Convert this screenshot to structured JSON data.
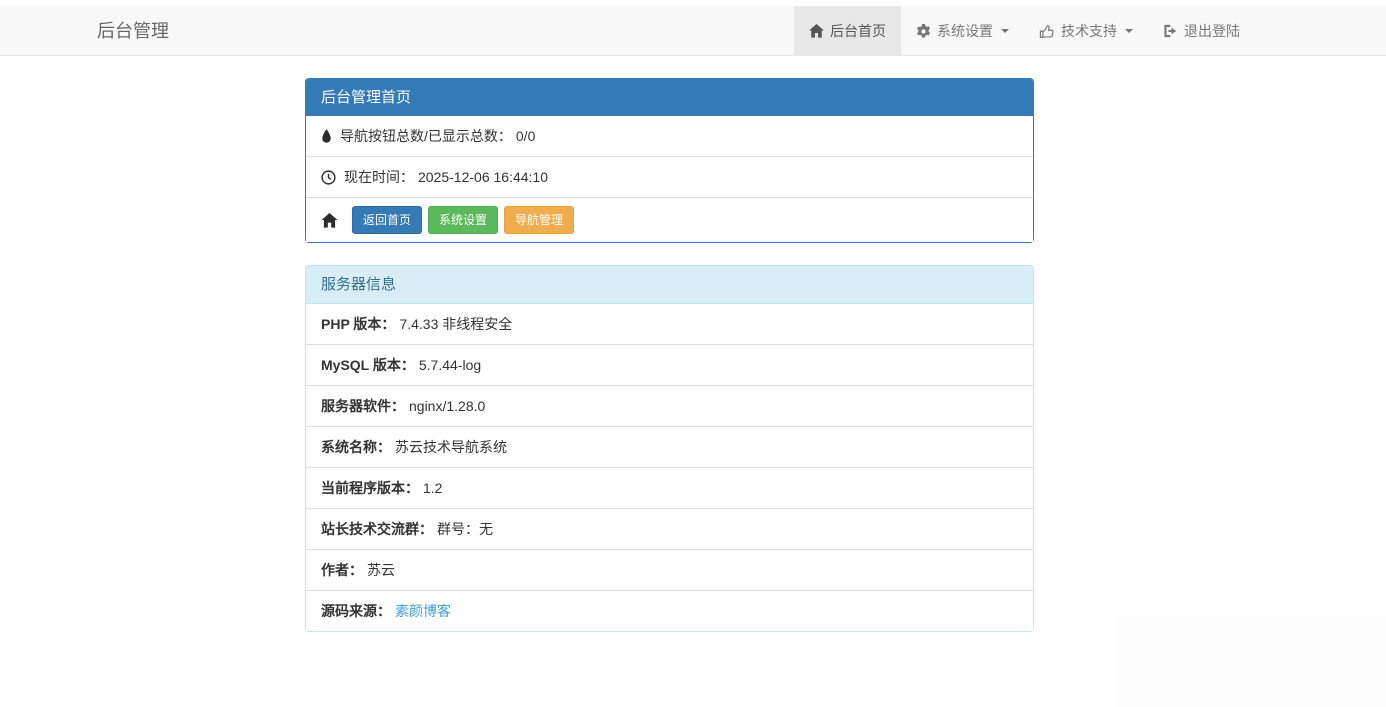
{
  "navbar": {
    "brand": "后台管理",
    "items": [
      {
        "label": "后台首页",
        "icon": "home-icon",
        "active": true
      },
      {
        "label": "系统设置",
        "icon": "gear-icon",
        "dropdown": true
      },
      {
        "label": "技术支持",
        "icon": "thumbs-up-icon",
        "dropdown": true
      },
      {
        "label": "退出登陆",
        "icon": "sign-out-icon"
      }
    ]
  },
  "dashboard": {
    "title": "后台管理首页",
    "nav_count_label": "导航按钮总数/已显示总数：",
    "nav_count_value": "0/0",
    "time_label": "现在时间：",
    "time_value": "2025-12-06 16:44:10",
    "buttons": [
      {
        "label": "返回首页",
        "color": "#337ab7"
      },
      {
        "label": "系统设置",
        "color": "#5cb85c"
      },
      {
        "label": "导航管理",
        "color": "#f0ad4e"
      }
    ]
  },
  "server_info": {
    "title": "服务器信息",
    "rows": [
      {
        "label": "PHP 版本：",
        "value": "7.4.33 非线程安全"
      },
      {
        "label": "MySQL 版本：",
        "value": "5.7.44-log"
      },
      {
        "label": "服务器软件：",
        "value": "nginx/1.28.0"
      },
      {
        "label": "系统名称：",
        "value": "苏云技术导航系统"
      },
      {
        "label": "当前程序版本：",
        "value": "1.2"
      },
      {
        "label": "站长技术交流群：",
        "value": "群号：无"
      },
      {
        "label": "作者：",
        "value": "苏云"
      },
      {
        "label": "源码来源：",
        "value": "素颜博客",
        "link": true
      }
    ]
  },
  "colors": {
    "navbar_bg": "#f8f8f8",
    "navbar_active_bg": "#e7e7e7",
    "navbar_text": "#777777",
    "primary": "#337ab7",
    "success": "#5cb85c",
    "warning": "#f0ad4e",
    "info_header_bg": "#d9edf7",
    "info_header_text": "#31708f",
    "info_border": "#bce8f1",
    "row_border": "#dddddd",
    "link": "#46a0d7"
  }
}
